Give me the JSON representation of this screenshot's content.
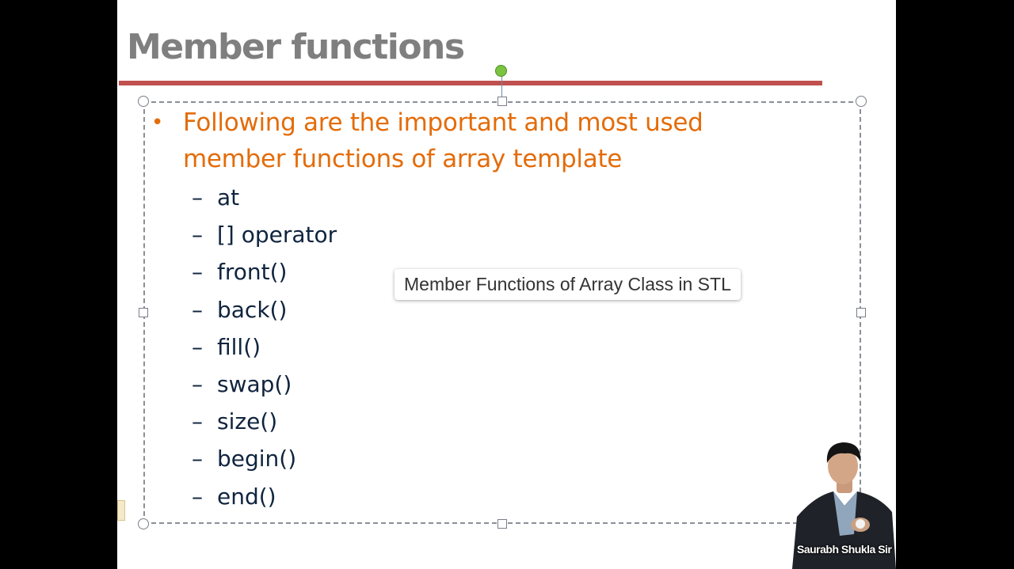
{
  "slide": {
    "title": "Member functions",
    "bullet": "Following are the important and most used member functions of array template",
    "sub_items": [
      {
        "dash": "–",
        "label": "at"
      },
      {
        "dash": "–",
        "label": "[] operator"
      },
      {
        "dash": "–",
        "label": "front()"
      },
      {
        "dash": "–",
        "label": "back()"
      },
      {
        "dash": "–",
        "label": "fill()"
      },
      {
        "dash": "–",
        "label": "swap()"
      },
      {
        "dash": "–",
        "label": "size()"
      },
      {
        "dash": "–",
        "label": "begin()"
      },
      {
        "dash": "–",
        "label": "end()"
      }
    ]
  },
  "caption": "Member Functions of Array Class in STL",
  "presenter": {
    "name": "Saurabh Shukla Sir"
  },
  "colors": {
    "title": "#7f7f7f",
    "rule": "#c0504d",
    "bullet": "#e36c0a",
    "sub_items": "#0f243e",
    "rotate_handle": "#7cc342"
  }
}
